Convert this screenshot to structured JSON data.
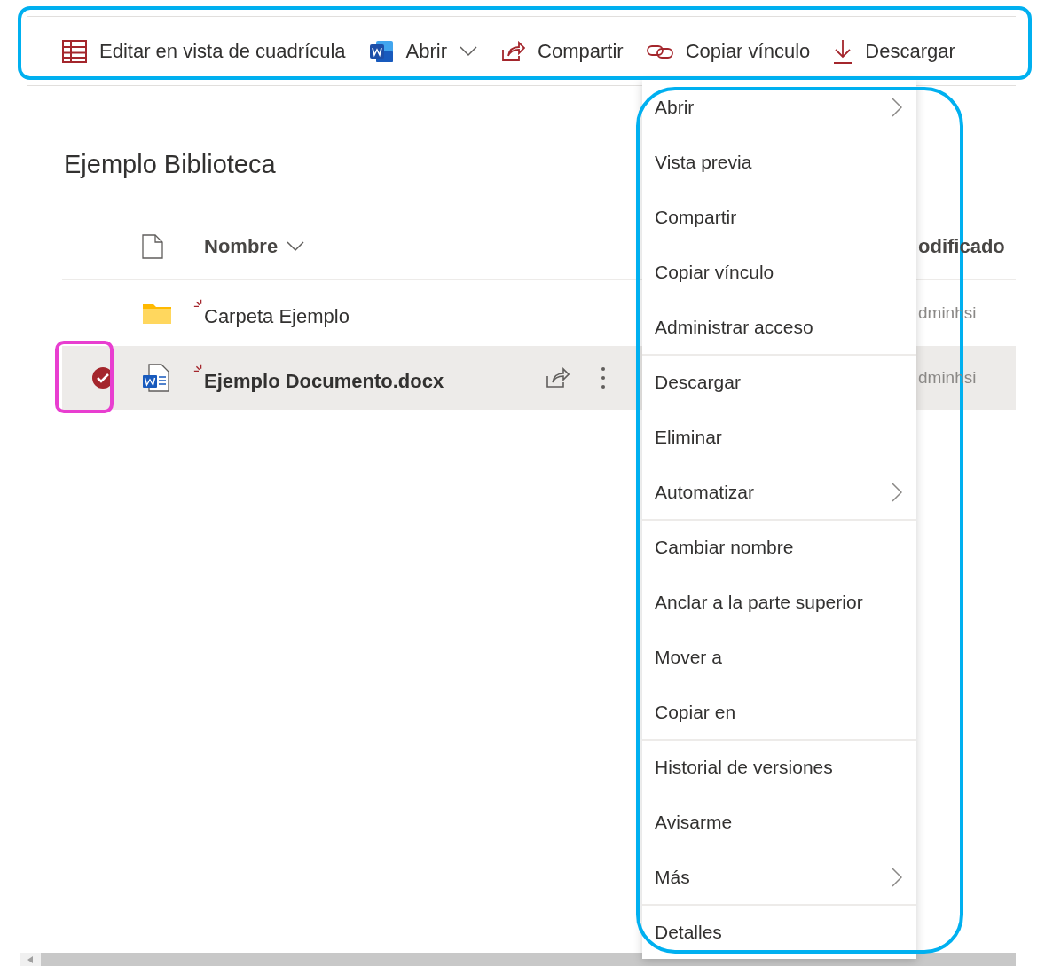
{
  "toolbar": {
    "items": [
      {
        "kind": "grid",
        "label": "Editar en vista de cuadrícula",
        "dropdown": false
      },
      {
        "kind": "word",
        "label": "Abrir",
        "dropdown": true
      },
      {
        "kind": "share",
        "label": "Compartir",
        "dropdown": false
      },
      {
        "kind": "link",
        "label": "Copiar vínculo",
        "dropdown": false
      },
      {
        "kind": "download",
        "label": "Descargar",
        "dropdown": false
      }
    ]
  },
  "library": {
    "title": "Ejemplo Biblioteca"
  },
  "table": {
    "columns": [
      {
        "label": "Nombre",
        "sortable": true
      },
      {
        "label": "odificado"
      }
    ],
    "rows": [
      {
        "kind": "folder",
        "name": "Carpeta Ejemplo",
        "new": true,
        "selected": false,
        "modified_by": "dminhsi"
      },
      {
        "kind": "word",
        "name": "Ejemplo Documento.docx",
        "new": true,
        "selected": true,
        "modified_by": "dminhsi"
      }
    ]
  },
  "context_menu": {
    "items": [
      {
        "label": "Abrir",
        "submenu": true,
        "divider_before": false
      },
      {
        "label": "Vista previa",
        "submenu": false,
        "divider_before": false
      },
      {
        "label": "Compartir",
        "submenu": false,
        "divider_before": false
      },
      {
        "label": "Copiar vínculo",
        "submenu": false,
        "divider_before": false
      },
      {
        "label": "Administrar acceso",
        "submenu": false,
        "divider_before": false
      },
      {
        "label": "Descargar",
        "submenu": false,
        "divider_before": true
      },
      {
        "label": "Eliminar",
        "submenu": false,
        "divider_before": false
      },
      {
        "label": "Automatizar",
        "submenu": true,
        "divider_before": false
      },
      {
        "label": "Cambiar nombre",
        "submenu": false,
        "divider_before": true
      },
      {
        "label": "Anclar a la parte superior",
        "submenu": false,
        "divider_before": false
      },
      {
        "label": "Mover a",
        "submenu": false,
        "divider_before": false
      },
      {
        "label": "Copiar en",
        "submenu": false,
        "divider_before": false
      },
      {
        "label": "Historial de versiones",
        "submenu": false,
        "divider_before": true
      },
      {
        "label": "Avisarme",
        "submenu": false,
        "divider_before": false
      },
      {
        "label": "Más",
        "submenu": true,
        "divider_before": false
      },
      {
        "label": "Detalles",
        "submenu": false,
        "divider_before": true
      }
    ]
  },
  "annotations": [
    {
      "kind": "toolbar",
      "color": "#00b0f0"
    },
    {
      "kind": "selection",
      "color": "#e83ed0"
    },
    {
      "kind": "menu",
      "color": "#00b0f0"
    }
  ]
}
